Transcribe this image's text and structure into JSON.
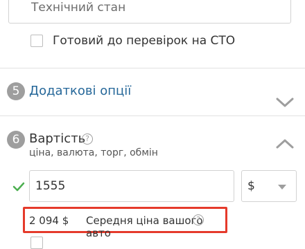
{
  "tech_state": {
    "placeholder": "Технічний стан"
  },
  "sto_checkbox": {
    "label": "Готовий до перевірок на СТО"
  },
  "section5": {
    "number": "5",
    "title": "Додаткові опції"
  },
  "section6": {
    "number": "6",
    "title": "Вартість",
    "subtitle": "ціна, валюта, торг, обмін",
    "help": "?"
  },
  "price": {
    "value": "1555",
    "currency": "$"
  },
  "average": {
    "amount": "2 094 $",
    "label": "Середня ціна вашого авто",
    "help": "?"
  },
  "colors": {
    "link": "#256799",
    "check": "#4caf50",
    "highlight": "#e53a2b",
    "step": "#9e9e9e"
  }
}
